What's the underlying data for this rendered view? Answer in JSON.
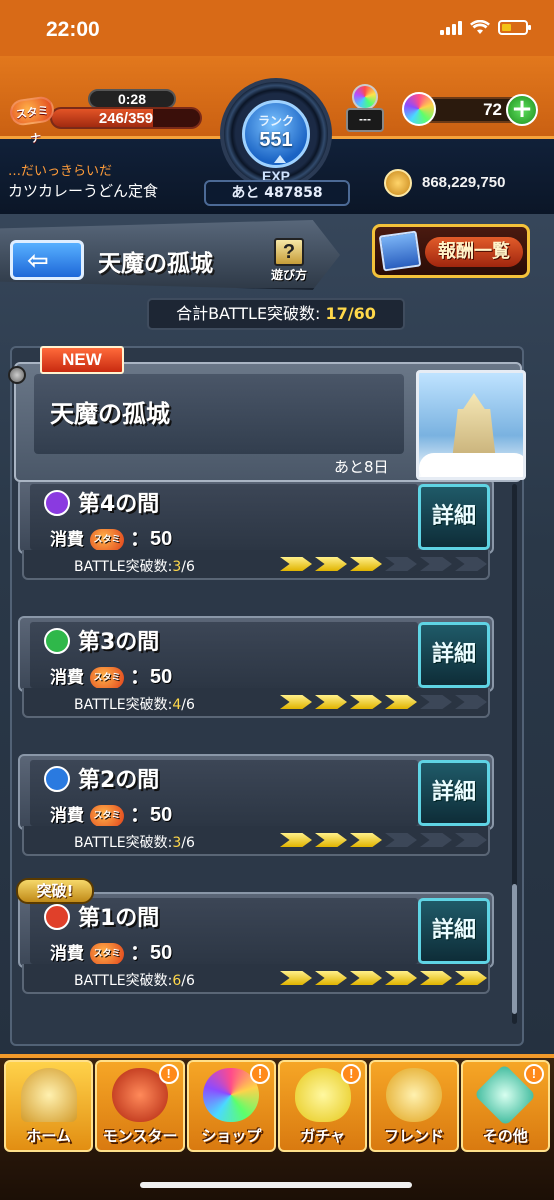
{
  "status_bar": {
    "time": "22:00"
  },
  "header": {
    "stamina": {
      "label": "スタミナ",
      "timer": "0:28",
      "current": 246,
      "max": 359,
      "display": "246/359",
      "fraction": 0.685
    },
    "rank": {
      "label": "ランク",
      "value": "551"
    },
    "exp": {
      "label": "EXP",
      "remaining": "あと 487858"
    },
    "item_counter": "---",
    "orbs": {
      "count": "72",
      "add": "+"
    },
    "user": {
      "subtitle": "…だいっきらいだ",
      "name": "カツカレーうどん定食"
    },
    "coins": "868,229,750"
  },
  "top_bar": {
    "back_arrow": "⇦",
    "title": "天魔の孤城",
    "help_icon": "?",
    "help_label": "遊び方",
    "reward_label": "報酬一覧"
  },
  "battle_total": {
    "label": "合計BATTLE突破数:",
    "value": "17/60"
  },
  "featured": {
    "badge": "NEW",
    "title": "天魔の孤城",
    "remaining": "あと8日"
  },
  "stages": [
    {
      "title": "第4の間",
      "cost_label": "消費",
      "stamina_tag": "スタミナ",
      "cost": "：50",
      "detail": "詳細",
      "battle_label": "BATTLE突破数:",
      "progress": "3",
      "progress_total": "/6",
      "cleared": 3,
      "total": 6,
      "icon_color": "#8a3ae0",
      "badge": ""
    },
    {
      "title": "第3の間",
      "cost_label": "消費",
      "stamina_tag": "スタミナ",
      "cost": "：50",
      "detail": "詳細",
      "battle_label": "BATTLE突破数:",
      "progress": "4",
      "progress_total": "/6",
      "cleared": 4,
      "total": 6,
      "icon_color": "#2fb84a",
      "badge": ""
    },
    {
      "title": "第2の間",
      "cost_label": "消費",
      "stamina_tag": "スタミナ",
      "cost": "：50",
      "detail": "詳細",
      "battle_label": "BATTLE突破数:",
      "progress": "3",
      "progress_total": "/6",
      "cleared": 3,
      "total": 6,
      "icon_color": "#2a7ae0",
      "badge": ""
    },
    {
      "title": "第1の間",
      "cost_label": "消費",
      "stamina_tag": "スタミナ",
      "cost": "：50",
      "detail": "詳細",
      "battle_label": "BATTLE突破数:",
      "progress": "6",
      "progress_total": "/6",
      "cleared": 6,
      "total": 6,
      "icon_color": "#e0402a",
      "badge": "突破!"
    }
  ],
  "nav": [
    {
      "label": "ホーム",
      "icon": "home-icon",
      "alert": ""
    },
    {
      "label": "モンスター",
      "icon": "monster-icon",
      "alert": "!"
    },
    {
      "label": "ショップ",
      "icon": "shop-orb-icon",
      "alert": "!"
    },
    {
      "label": "ガチャ",
      "icon": "gacha-egg-icon",
      "alert": "!"
    },
    {
      "label": "フレンド",
      "icon": "friend-icon",
      "alert": ""
    },
    {
      "label": "その他",
      "icon": "other-icon",
      "alert": "!"
    }
  ],
  "colors": {
    "accent": "#e2781d",
    "detail_border": "#5fd4e4",
    "progress_on": "#f0c800"
  }
}
